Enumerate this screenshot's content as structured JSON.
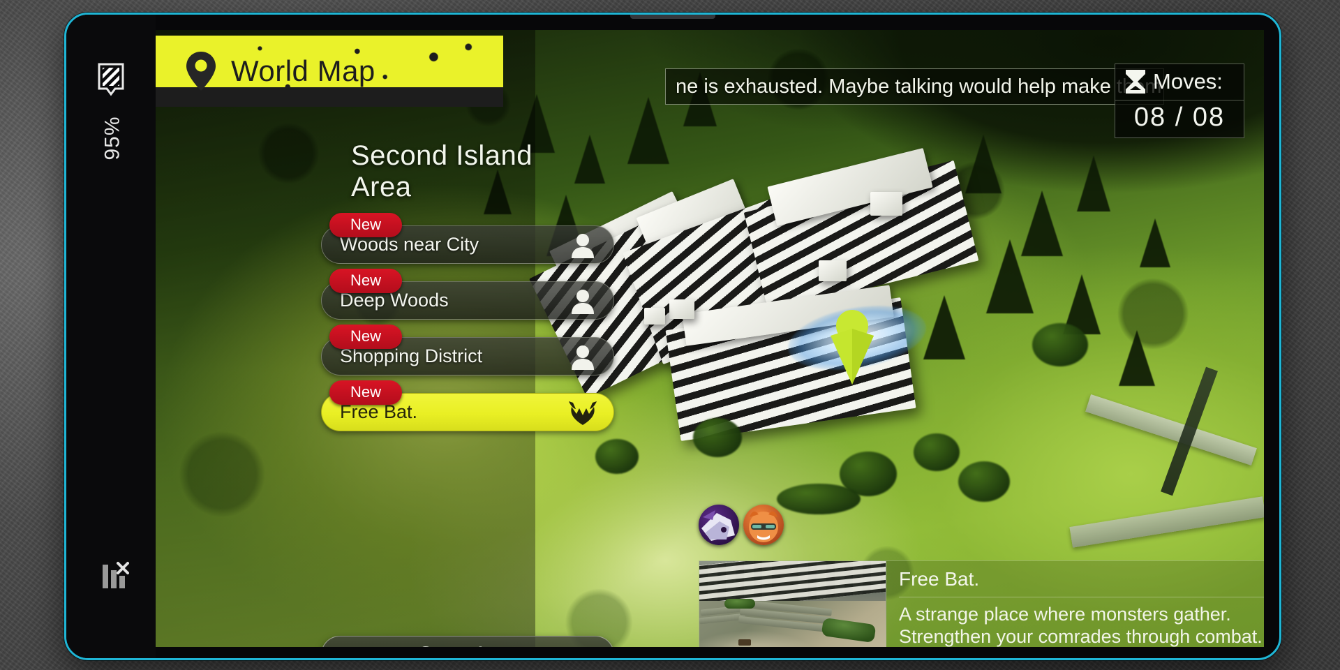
{
  "device": {
    "battery_icon": "battery-icon",
    "battery_percent": "95%",
    "signal_icon": "no-signal-icon",
    "bezel_color": "#1fb6d6"
  },
  "sidebar": {
    "header": {
      "pin_icon": "location-pin-icon",
      "title": "World Map",
      "banner_color": "#eaf22a"
    },
    "area_name": "Second Island Area",
    "areas": [
      {
        "badge": "New",
        "label": "Woods near City",
        "icon": "person-silhouette-icon",
        "selected": false
      },
      {
        "badge": "New",
        "label": "Deep Woods",
        "icon": "person-silhouette-icon",
        "selected": false
      },
      {
        "badge": "New",
        "label": "Shopping District",
        "icon": "person-silhouette-icon",
        "selected": false
      },
      {
        "badge": "New",
        "label": "Free Bat.",
        "icon": "horned-demon-icon",
        "selected": true
      }
    ],
    "go_to_area_label": "Go to Area"
  },
  "hud": {
    "dialogue_text": "ne is exhausted. Maybe talking would help make them",
    "moves": {
      "icon": "hourglass-icon",
      "label": "Moves:",
      "value": "08 / 08"
    }
  },
  "map": {
    "marker_icon": "player-location-marker",
    "party": [
      {
        "name": "party-avatar-1"
      },
      {
        "name": "party-avatar-2"
      }
    ]
  },
  "info_panel": {
    "thumbnail": "area-thumbnail-free-battle",
    "title": "Free Bat.",
    "description_lines": [
      "A strange place where monsters gather.",
      "Strengthen your comrades through combat."
    ]
  },
  "colors": {
    "accent_yellow": "#eaf22a",
    "badge_red": "#d81424",
    "bezel_cyan": "#1fb6d6"
  }
}
